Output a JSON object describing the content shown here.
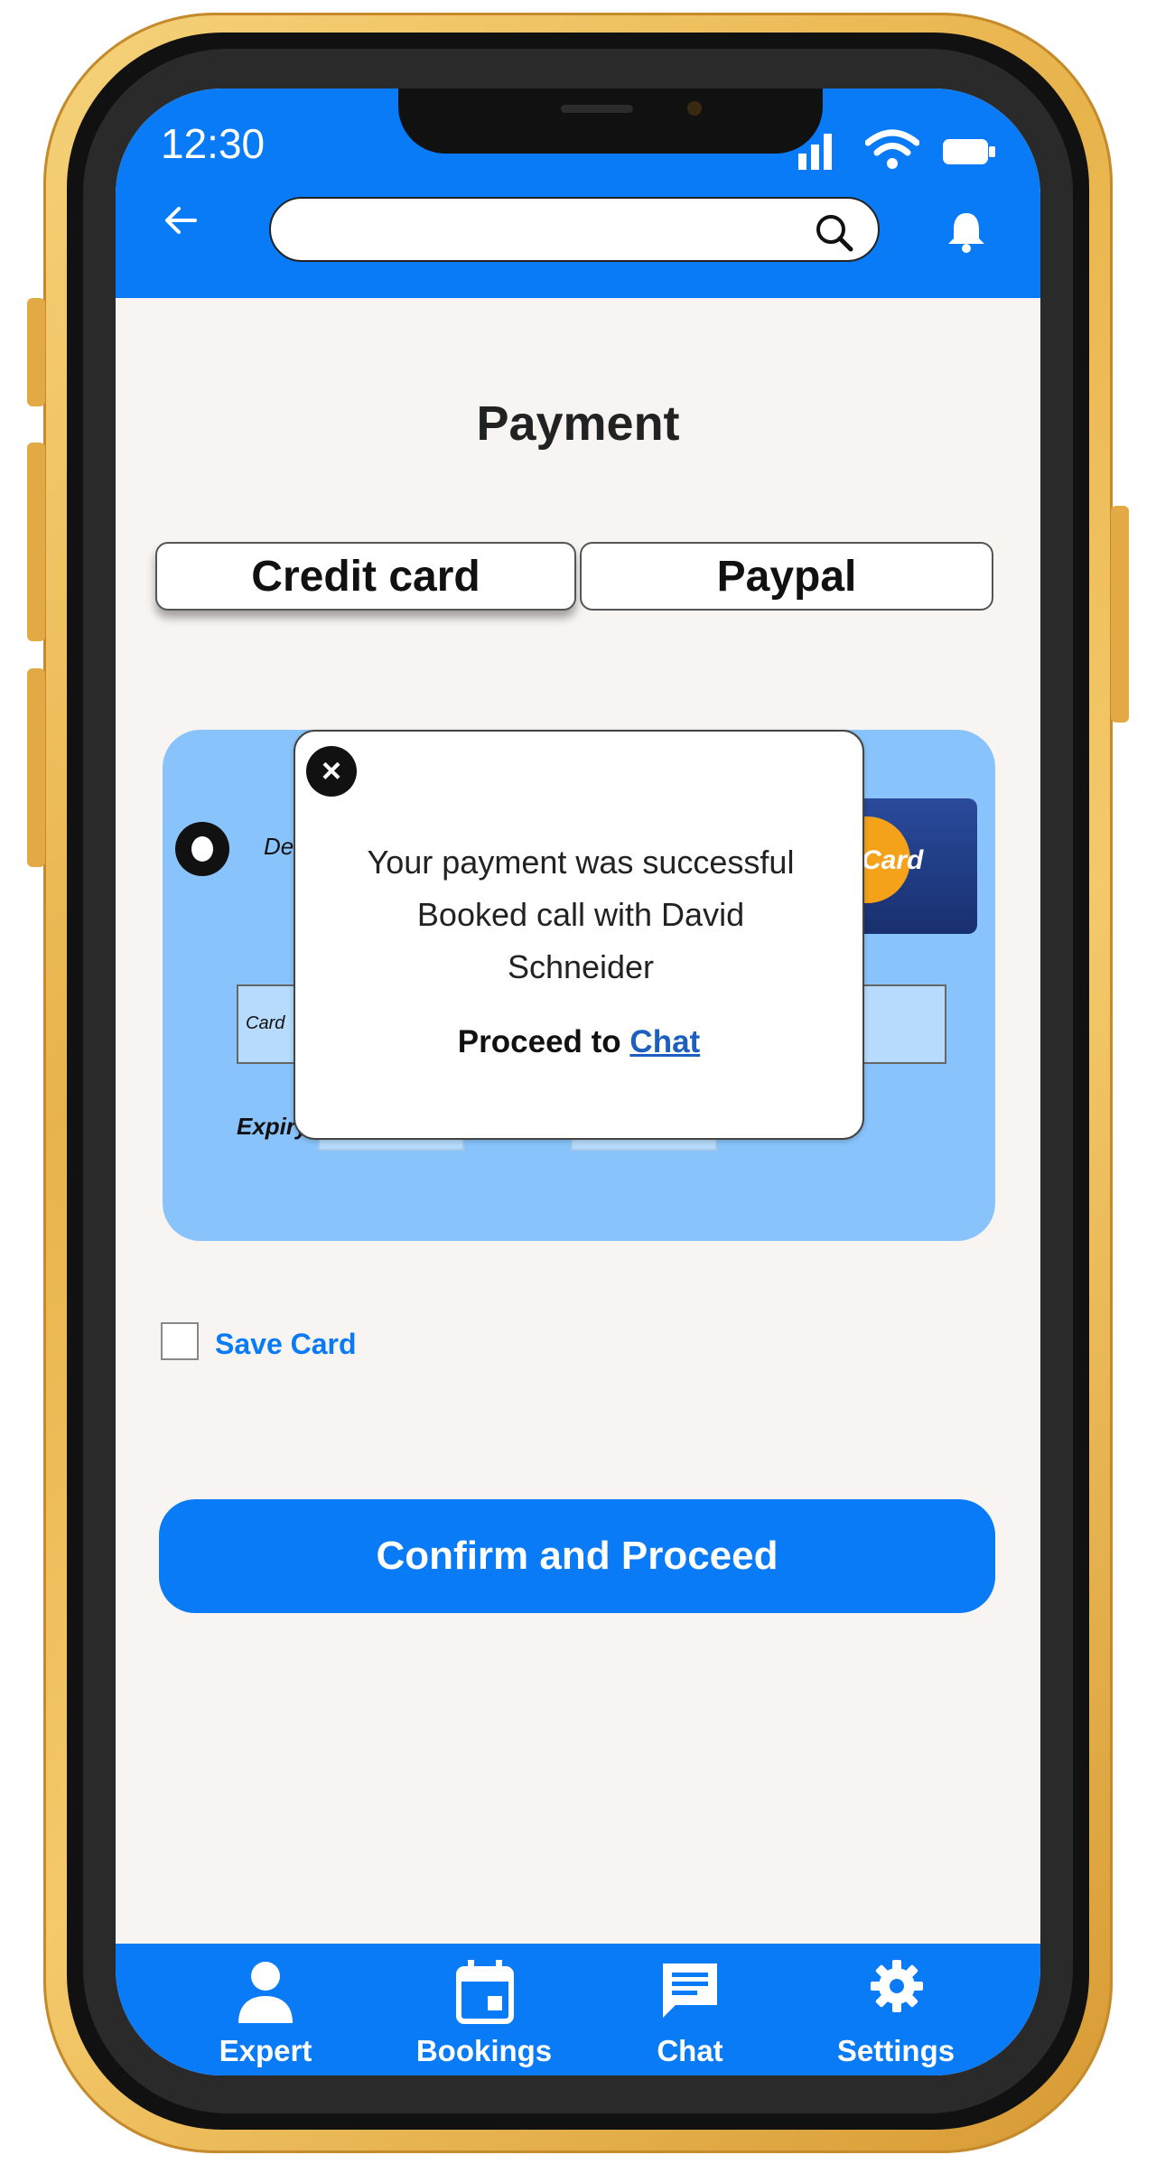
{
  "status_bar": {
    "time": "12:30"
  },
  "header": {
    "search_placeholder": ""
  },
  "page": {
    "title": "Payment"
  },
  "tabs": [
    {
      "label": "Credit card",
      "selected": true
    },
    {
      "label": "Paypal",
      "selected": false
    }
  ],
  "card_form": {
    "card_type_label": "De",
    "brand_text": "Card",
    "card_number_label": "Card",
    "expiry_label": "Expiry"
  },
  "save_card": {
    "label": "Save Card",
    "checked": false
  },
  "confirm_button": {
    "label": "Confirm and Proceed"
  },
  "popup": {
    "message_line1": "Your payment was successful",
    "message_line2": "Booked call with David",
    "message_line3": "Schneider",
    "proceed_text": "Proceed to",
    "proceed_link": "Chat"
  },
  "bottom_nav": {
    "items": [
      {
        "label": "Expert",
        "icon": "person-icon"
      },
      {
        "label": "Bookings",
        "icon": "calendar-icon"
      },
      {
        "label": "Chat",
        "icon": "chat-icon"
      },
      {
        "label": "Settings",
        "icon": "gear-icon"
      }
    ]
  },
  "colors": {
    "primary": "#0a7bf6",
    "card_panel": "#88c4fb",
    "background": "#f8f4f2",
    "link": "#1d5fbf"
  }
}
